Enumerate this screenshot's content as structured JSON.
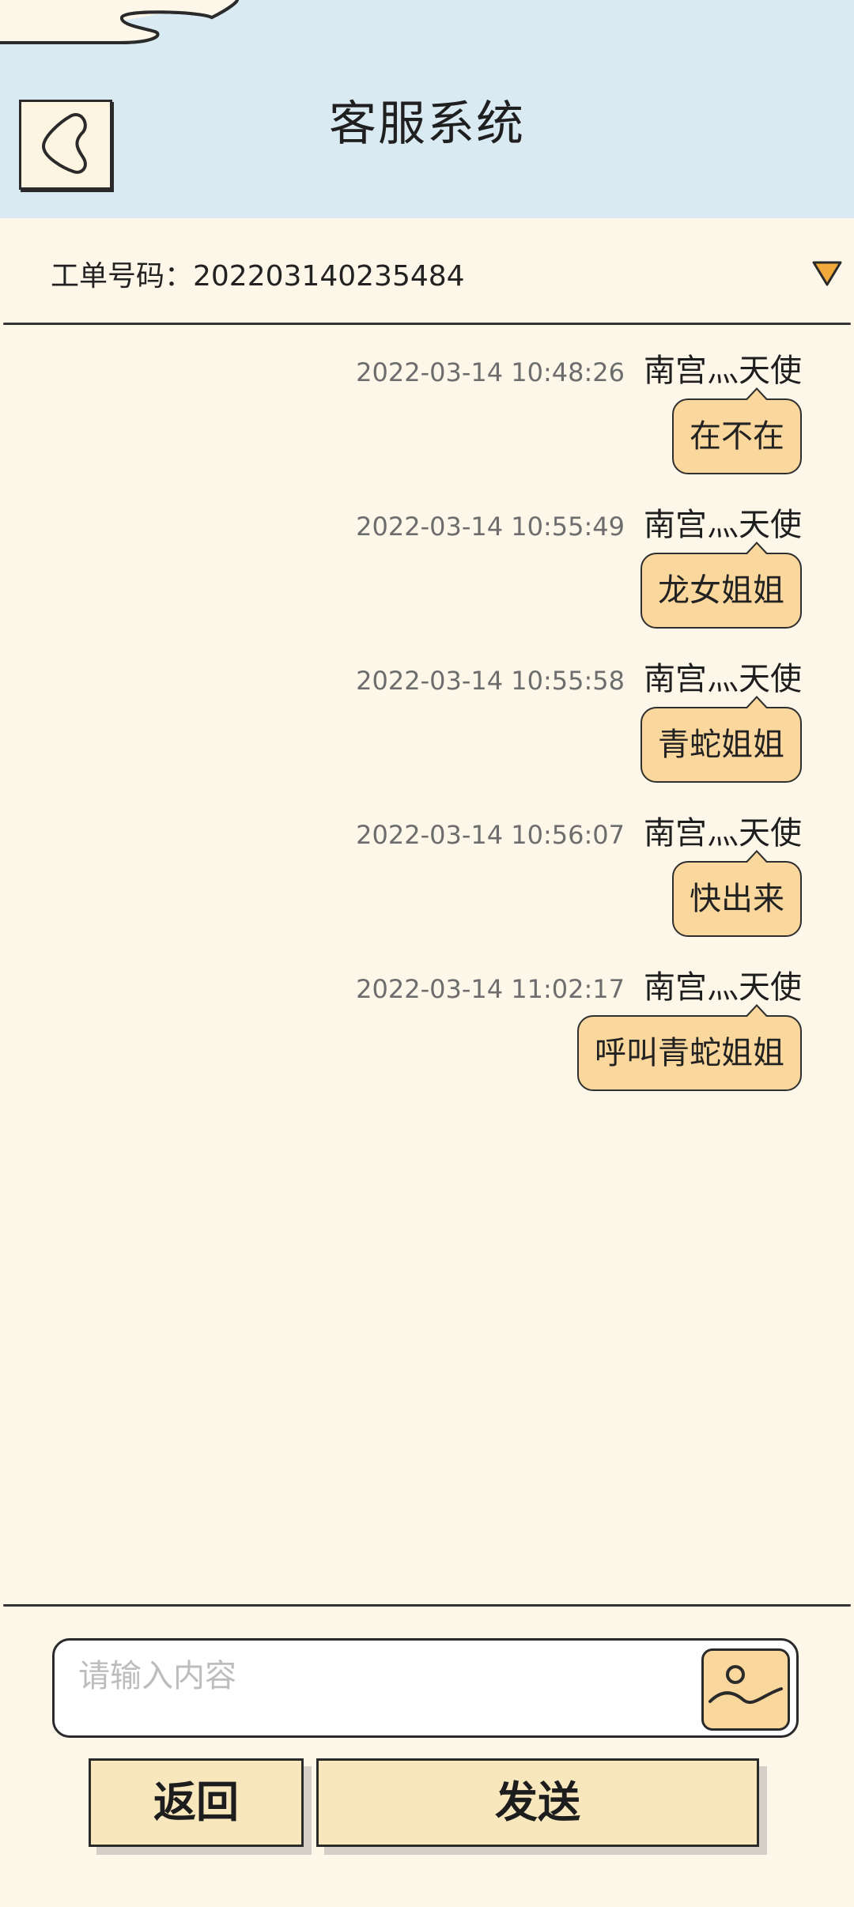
{
  "header": {
    "title": "客服系统",
    "back_icon": "back-chevron-icon"
  },
  "ticket": {
    "label": "工单号码：202203140235484",
    "toggle_icon": "triangle-down-icon",
    "toggle_color": "#f2a93b"
  },
  "messages": [
    {
      "time": "2022-03-14 10:48:26",
      "sender": "南宫灬天使",
      "text": "在不在"
    },
    {
      "time": "2022-03-14 10:55:49",
      "sender": "南宫灬天使",
      "text": "龙女姐姐"
    },
    {
      "time": "2022-03-14 10:55:58",
      "sender": "南宫灬天使",
      "text": "青蛇姐姐"
    },
    {
      "time": "2022-03-14 10:56:07",
      "sender": "南宫灬天使",
      "text": "快出来"
    },
    {
      "time": "2022-03-14 11:02:17",
      "sender": "南宫灬天使",
      "text": "呼叫青蛇姐姐"
    }
  ],
  "composer": {
    "placeholder": "请输入内容",
    "image_icon": "image-upload-icon"
  },
  "buttons": {
    "back_label": "返回",
    "send_label": "发送"
  },
  "colors": {
    "header_bg": "#d9eaf3",
    "page_bg": "#fdf7ea",
    "bubble_bg": "#fad79c",
    "button_bg": "#f8e6bd"
  }
}
